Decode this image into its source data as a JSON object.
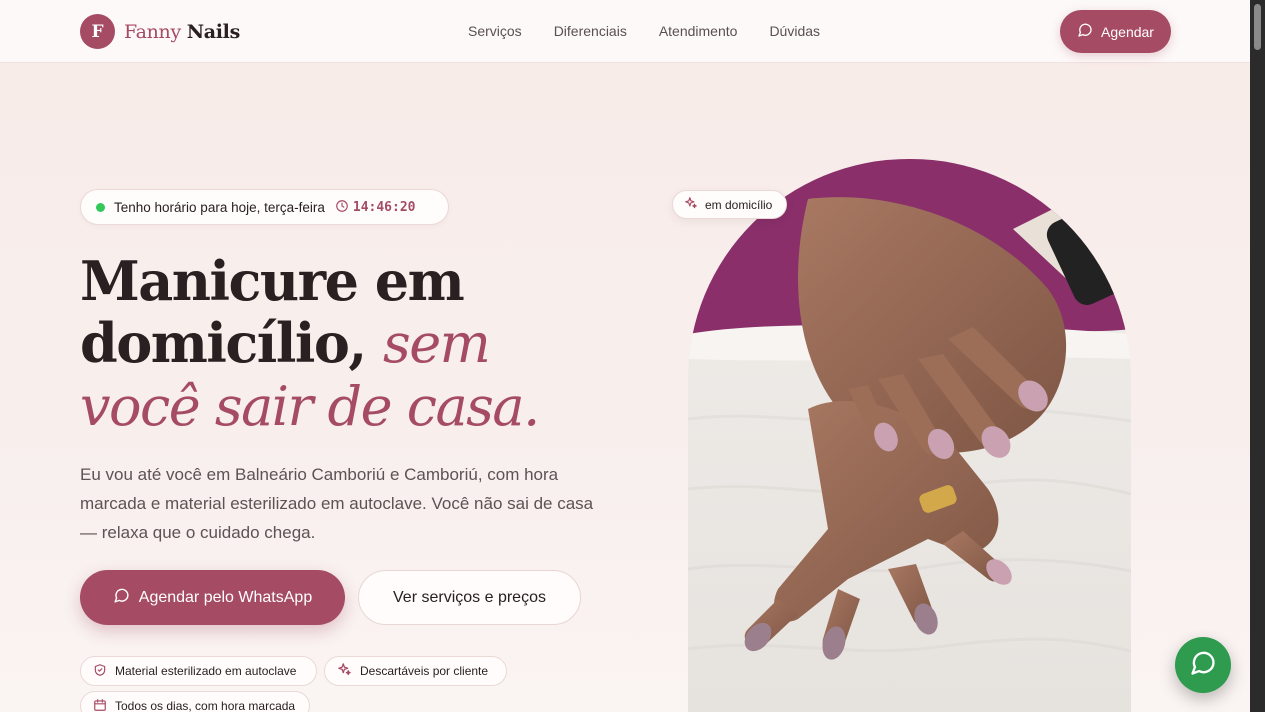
{
  "brand": {
    "initial": "F",
    "name_part1": "Fanny",
    "name_part2": "Nails"
  },
  "nav": {
    "items": [
      {
        "label": "Serviços"
      },
      {
        "label": "Diferenciais"
      },
      {
        "label": "Atendimento"
      },
      {
        "label": "Dúvidas"
      }
    ],
    "cta_label": "Agendar"
  },
  "availability": {
    "text": "Tenho horário para hoje, terça-feira",
    "time": "14:46:20",
    "status_color": "#34c759"
  },
  "hero": {
    "title_line1": "Manicure em",
    "title_line2": "domicílio,",
    "title_accent1": "sem",
    "title_accent2": "você sair de casa.",
    "lead": "Eu vou até você em Balneário Camboriú e Camboriú, com hora marcada e material esterilizado em autoclave. Você não sai de casa — relaxa que o cuidado chega.",
    "primary_cta": "Agendar pelo WhatsApp",
    "secondary_cta": "Ver serviços e preços"
  },
  "badges": [
    {
      "label": "Material esterilizado em autoclave",
      "icon": "shield-icon"
    },
    {
      "label": "Descartáveis por cliente",
      "icon": "sparkle-icon"
    },
    {
      "label": "Todos os dias, com hora marcada",
      "icon": "calendar-icon"
    }
  ],
  "photo_tag": "em domicílio",
  "colors": {
    "accent": "#a54b63",
    "whatsapp": "#2e9b4f"
  }
}
